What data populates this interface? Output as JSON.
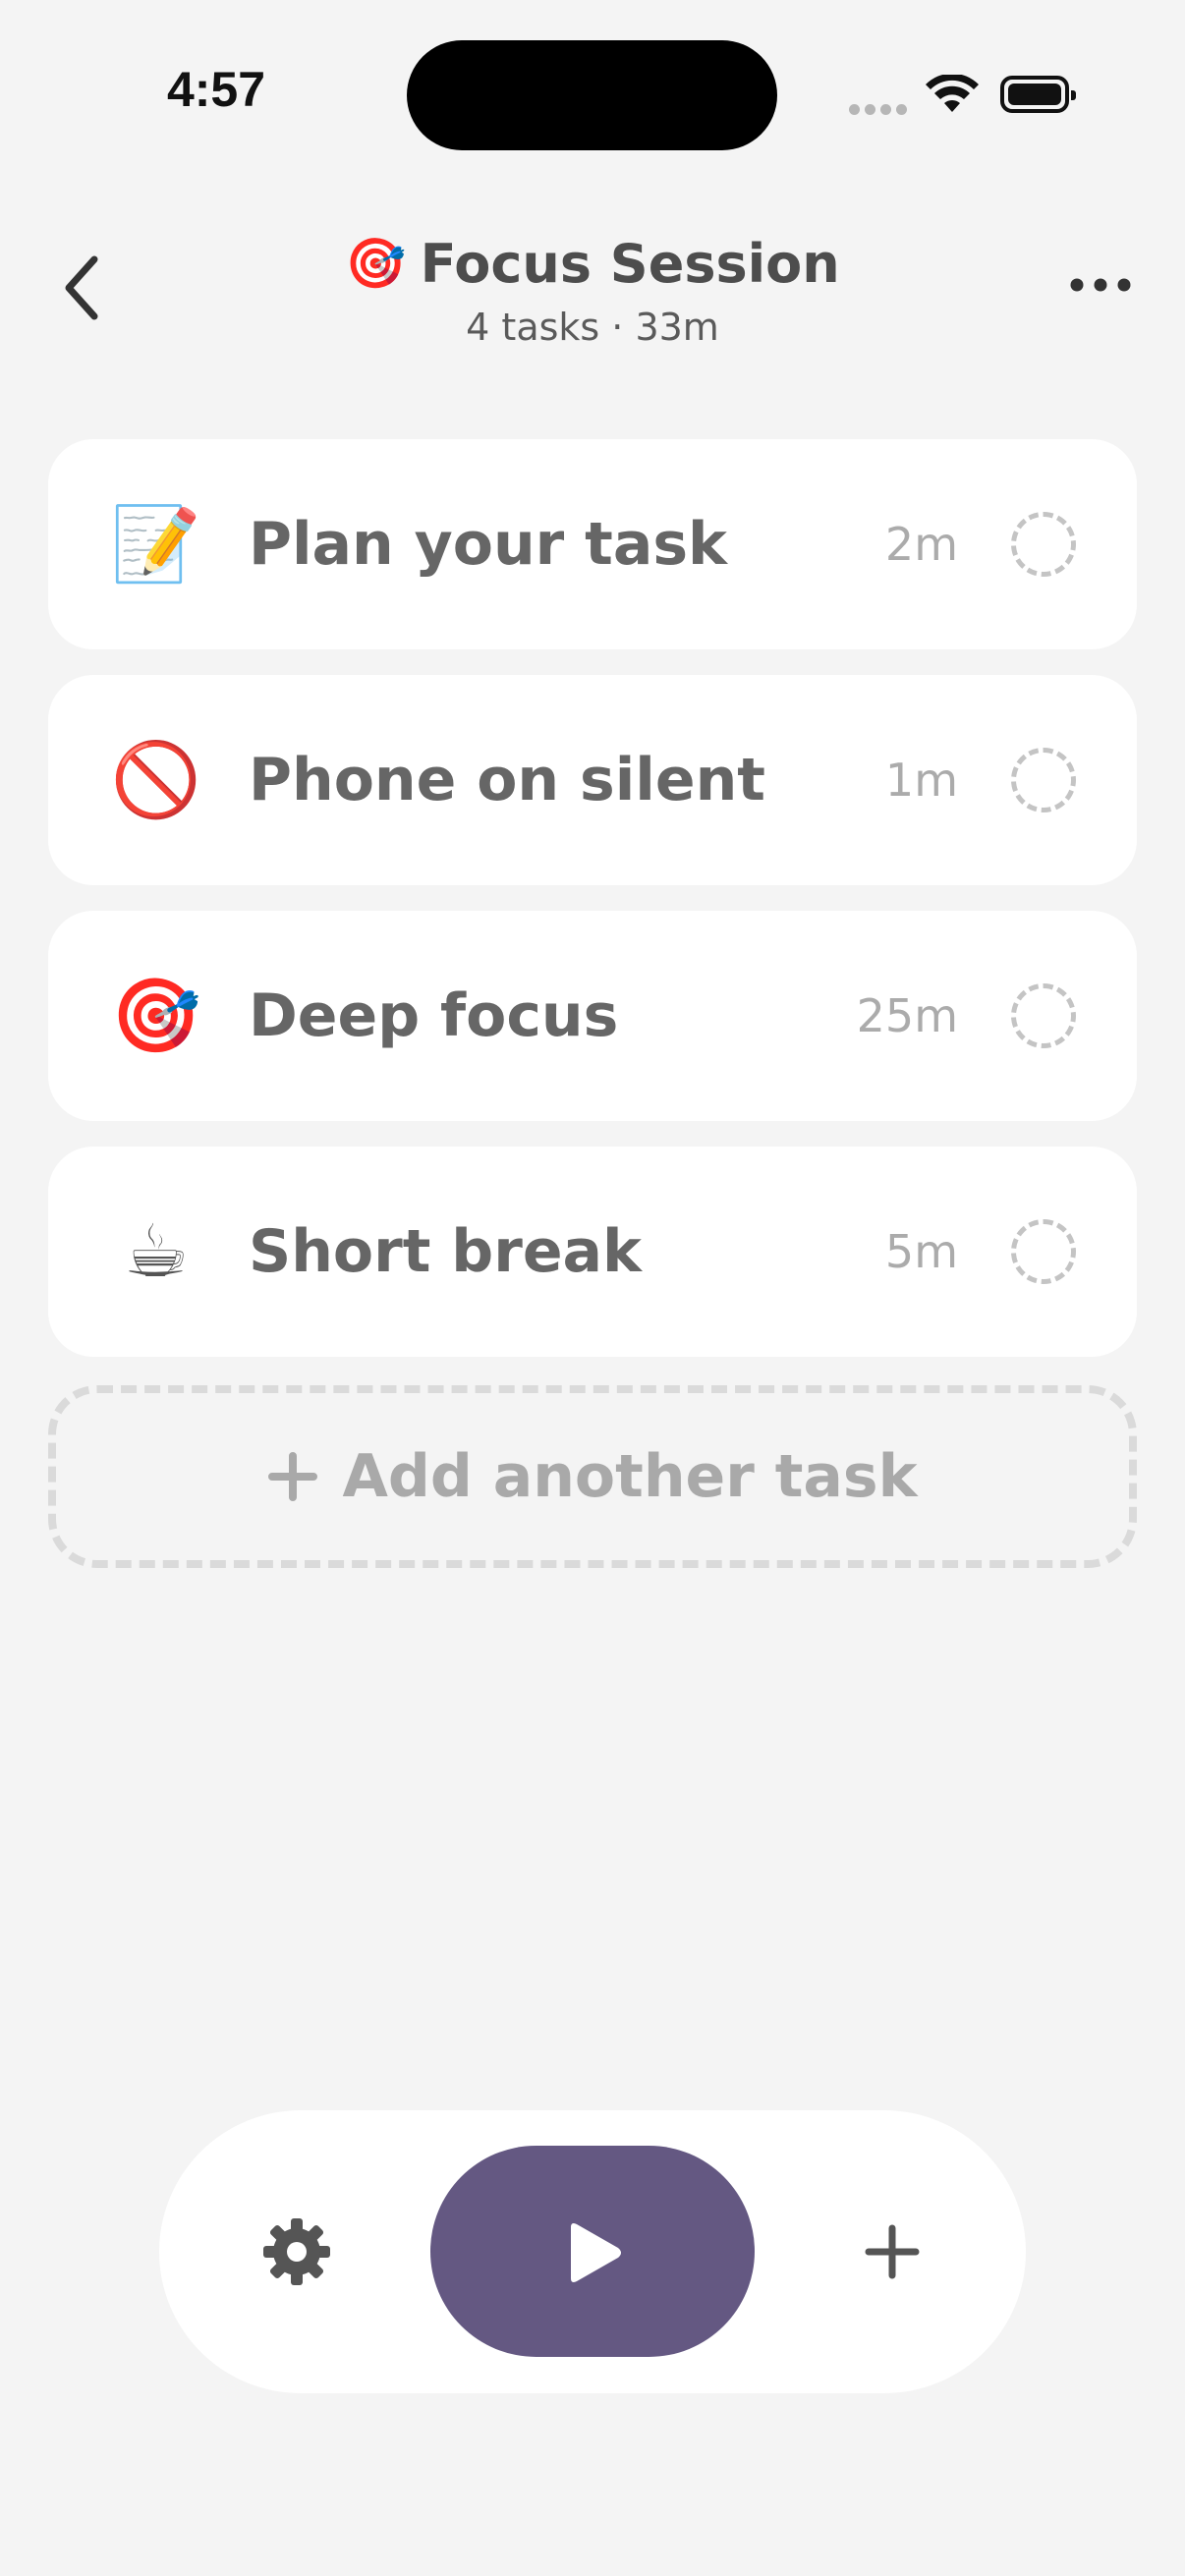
{
  "status_bar": {
    "time": "4:57"
  },
  "header": {
    "title_emoji": "🎯",
    "title": "Focus Session",
    "subtitle": "4 tasks · 33m",
    "back_icon": "chevron-left-icon",
    "more_icon": "ellipsis-icon"
  },
  "tasks": [
    {
      "emoji": "📝",
      "name": "Plan your task",
      "duration": "2m",
      "done": false
    },
    {
      "emoji": "🚫",
      "name": "Phone on silent",
      "duration": "1m",
      "done": false
    },
    {
      "emoji": "🎯",
      "name": "Deep focus",
      "duration": "25m",
      "done": false
    },
    {
      "emoji": "☕",
      "name": "Short break",
      "duration": "5m",
      "done": false
    }
  ],
  "add_task": {
    "icon": "plus-icon",
    "label": "Add another task"
  },
  "toolbar": {
    "settings_icon": "gear-icon",
    "play_icon": "play-icon",
    "add_icon": "plus-icon",
    "accent_color": "#645882"
  }
}
